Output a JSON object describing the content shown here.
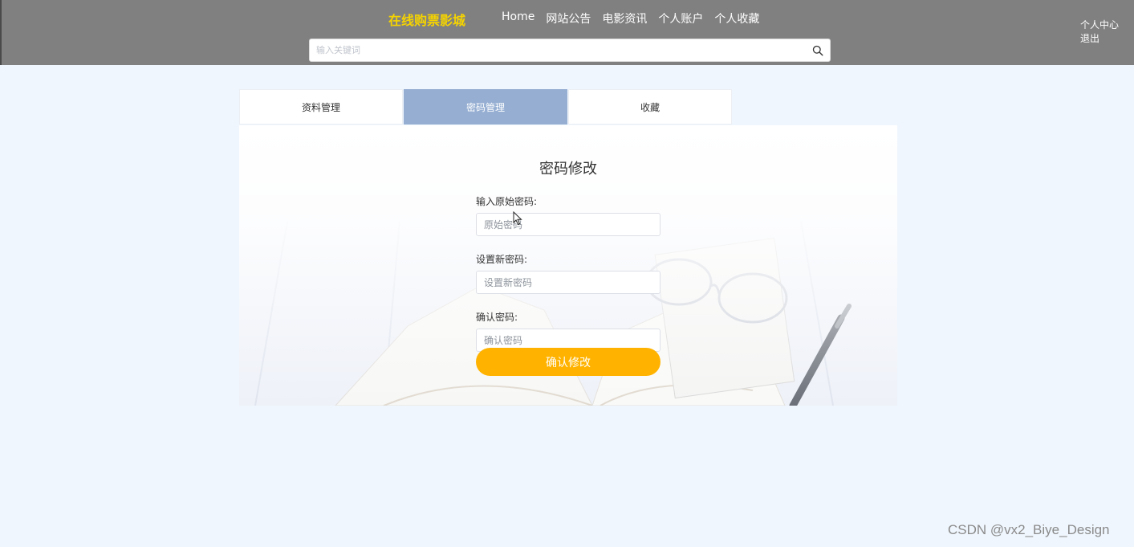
{
  "header": {
    "brand": "在线购票影城",
    "nav": [
      "Home",
      "网站公告",
      "电影资讯",
      "个人账户",
      "个人收藏"
    ],
    "search": {
      "placeholder": "输入关键词",
      "value": ""
    },
    "user_links": [
      "个人中心",
      "退出"
    ]
  },
  "tabs": [
    {
      "label": "资料管理",
      "active": false
    },
    {
      "label": "密码管理",
      "active": true
    },
    {
      "label": "收藏",
      "active": false
    }
  ],
  "form": {
    "title": "密码修改",
    "old_label": "输入原始密码:",
    "old_placeholder": "原始密码",
    "new_label": "设置新密码:",
    "new_placeholder": "设置新密码",
    "confirm_label": "确认密码:",
    "confirm_placeholder": "确认密码",
    "submit": "确认修改"
  },
  "watermark": "CSDN @vx2_Biye_Design",
  "colors": {
    "header_bg": "#808080",
    "brand": "#f5d300",
    "page_bg": "#eff6fd",
    "active_tab": "#95aed2",
    "submit": "#ffb300"
  }
}
